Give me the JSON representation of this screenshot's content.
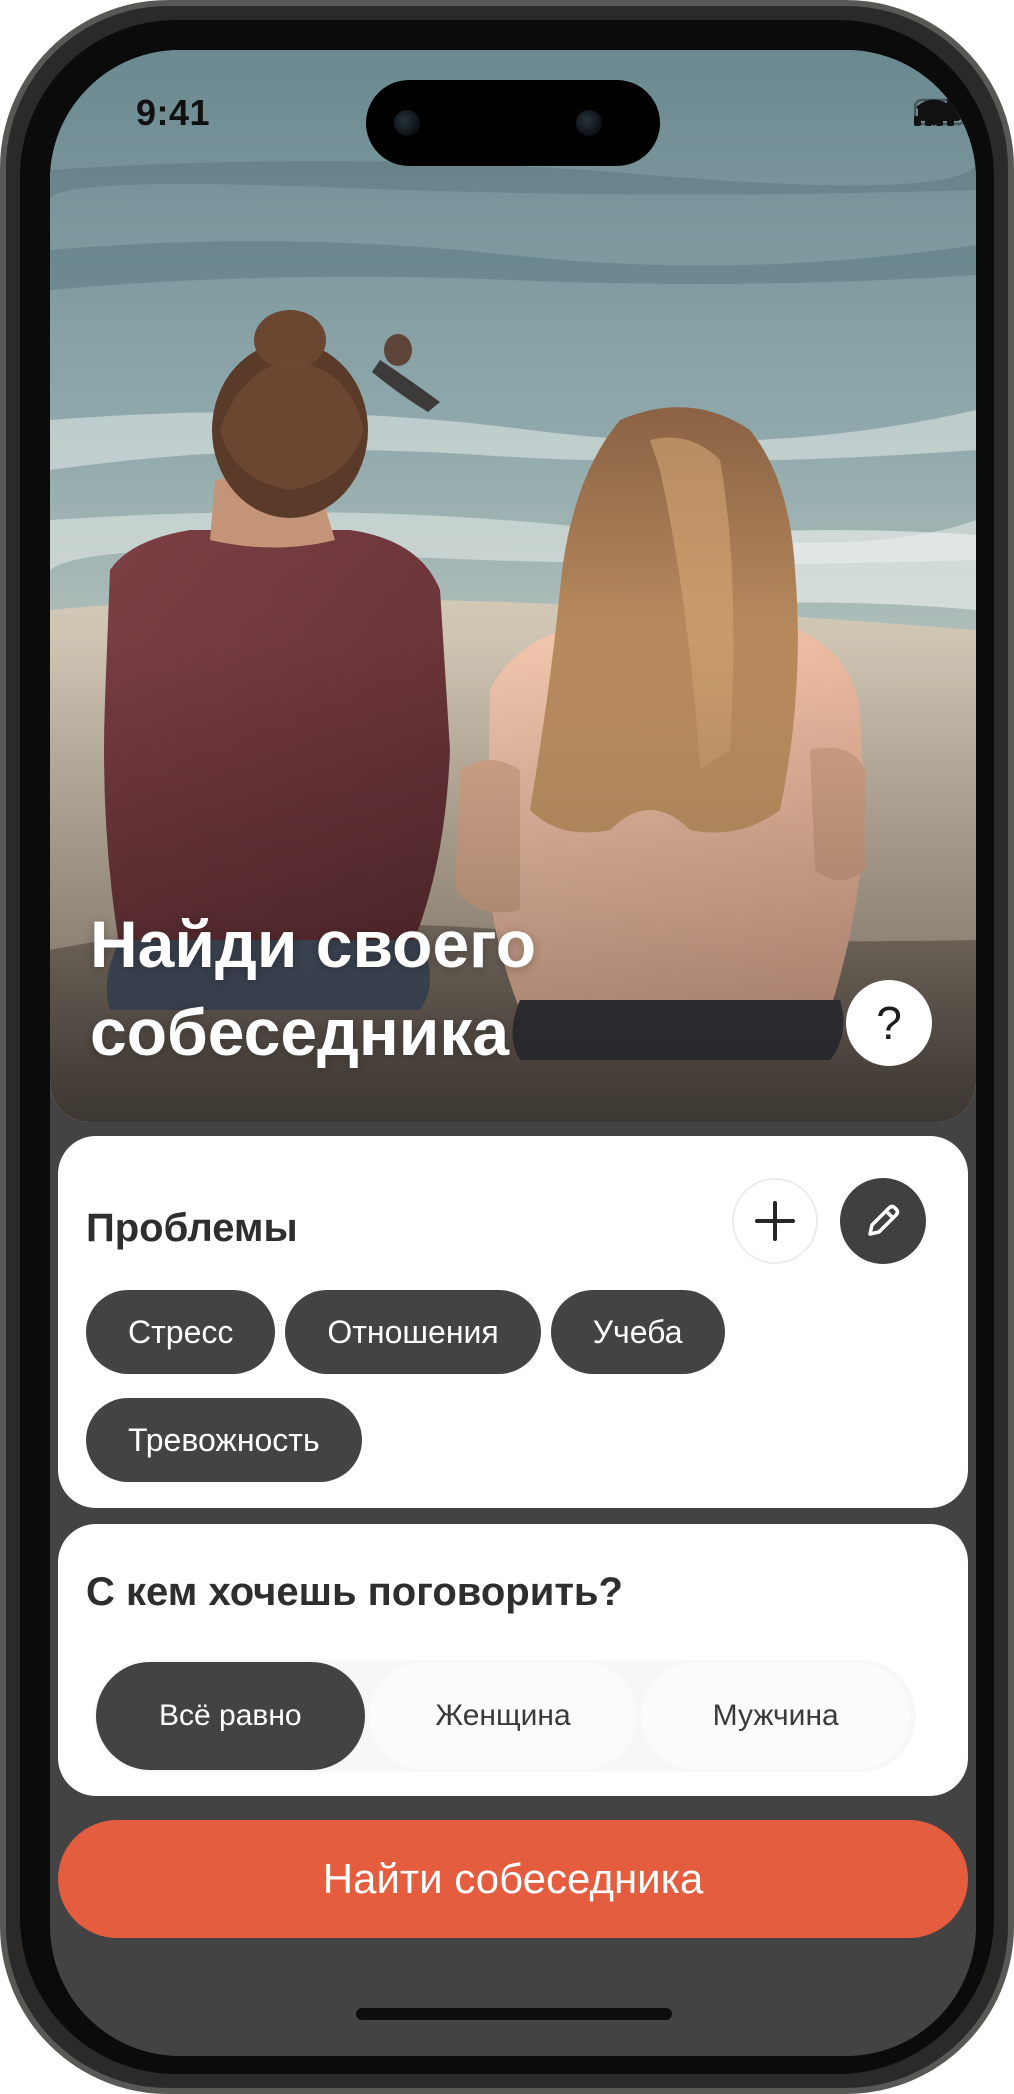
{
  "status_bar": {
    "time": "9:41",
    "icons": [
      "signal-icon",
      "wifi-icon",
      "battery-icon"
    ]
  },
  "hero": {
    "title_line1": "Найди своего",
    "title_line2": "собеседника",
    "help_label": "?"
  },
  "problems": {
    "title": "Проблемы",
    "add_icon": "plus-icon",
    "edit_icon": "pencil-icon",
    "chips": [
      "Стресс",
      "Отношения",
      "Учеба",
      "Тревожность"
    ]
  },
  "partner": {
    "title": "С кем хочешь поговорить?",
    "options": [
      "Всё равно",
      "Женщина",
      "Мужчина"
    ],
    "selected": "Всё равно"
  },
  "cta": {
    "label": "Найти собеседника"
  },
  "colors": {
    "accent": "#e35d3e",
    "dark": "#434343",
    "card": "#ffffff"
  }
}
